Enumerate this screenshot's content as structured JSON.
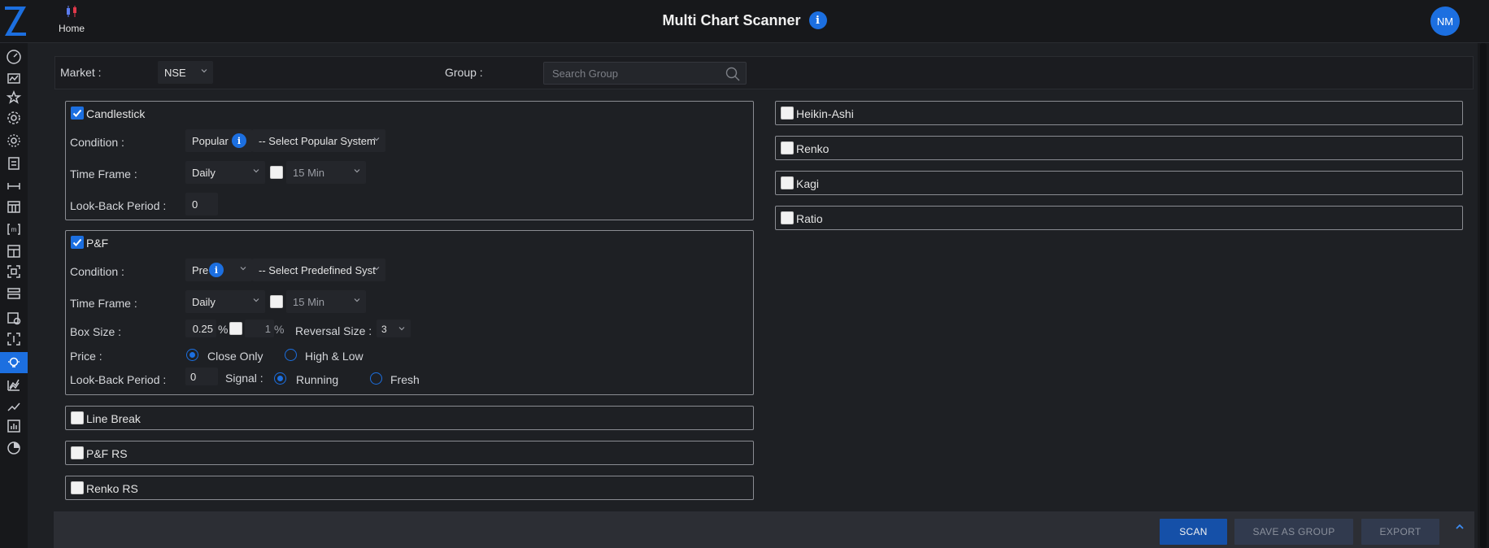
{
  "header": {
    "home_label": "Home",
    "title": "Multi Chart Scanner",
    "info_glyph": "i",
    "avatar_initials": "NM"
  },
  "colors": {
    "accent": "#1c6fe0",
    "background": "#1e2024",
    "header_bg": "#17181b",
    "panel_border": "#8a8c92"
  },
  "sidebar": {
    "icons": [
      "speedometer-icon",
      "image-chart-icon",
      "star-icon",
      "gear-icon",
      "gear-alt-icon",
      "clipboard-icon",
      "resize-horizontal-icon",
      "calendar-grid-icon",
      "m-bracket-icon",
      "layout-icon",
      "scan-frame-icon",
      "list-stack-icon",
      "calendar-clock-icon",
      "scan-grid-icon",
      "lightbulb-icon",
      "multi-chart-icon",
      "trend-line-icon",
      "bar-chart-icon",
      "pie-gear-icon"
    ],
    "active_index": 14
  },
  "market": {
    "label": "Market :",
    "value": "NSE",
    "group_label": "Group :",
    "group_placeholder": "Search Group"
  },
  "candlestick": {
    "checkbox_label": "Candlestick",
    "checked": true,
    "condition_label": "Condition :",
    "condition_type": "Popular",
    "condition_system": "-- Select Popular System",
    "timeframe_label": "Time Frame :",
    "timeframe": "Daily",
    "timeframe2_checked": false,
    "timeframe2": "15 Min",
    "lookback_label": "Look-Back Period :",
    "lookback_value": "0"
  },
  "pnf": {
    "checkbox_label": "P&F",
    "checked": true,
    "condition_label": "Condition :",
    "condition_type": "Pre",
    "condition_system": "-- Select Predefined Syst",
    "timeframe_label": "Time Frame :",
    "timeframe": "Daily",
    "timeframe2_checked": false,
    "timeframe2": "15 Min",
    "box_size_label": "Box Size :",
    "box_size_value": "0.25",
    "box_size_unit": "%",
    "box_size2_checked": false,
    "box_size2_value": "1",
    "box_size2_unit": "%",
    "reversal_label": "Reversal Size :",
    "reversal_value": "3",
    "price_label": "Price :",
    "price_options": [
      "Close Only",
      "High & Low"
    ],
    "price_selected": 0,
    "lookback_label": "Look-Back Period :",
    "lookback_value": "0",
    "signal_label": "Signal :",
    "signal_options": [
      "Running",
      "Fresh"
    ],
    "signal_selected": 0
  },
  "left_collapsed": [
    {
      "label": "Line Break",
      "checked": false
    },
    {
      "label": "P&F RS",
      "checked": false
    },
    {
      "label": "Renko RS",
      "checked": false
    }
  ],
  "right_collapsed": [
    {
      "label": "Heikin-Ashi",
      "checked": false
    },
    {
      "label": "Renko",
      "checked": false
    },
    {
      "label": "Kagi",
      "checked": false
    },
    {
      "label": "Ratio",
      "checked": false
    }
  ],
  "footer": {
    "scan_label": "SCAN",
    "save_label": "SAVE AS GROUP",
    "export_label": "EXPORT"
  }
}
